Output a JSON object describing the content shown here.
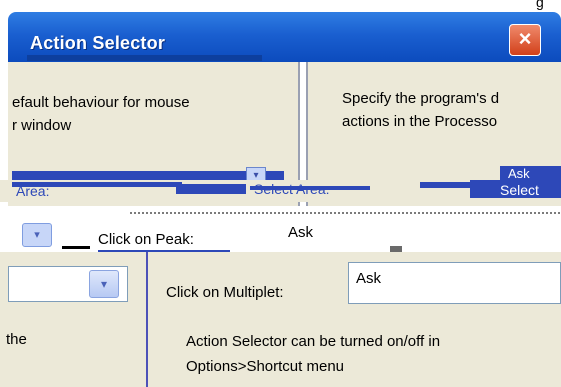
{
  "corner_text": "g",
  "window": {
    "title": "Action Selector",
    "close_glyph": "×"
  },
  "left_panel": {
    "description_line1": "efault behaviour for mouse",
    "description_line2": "r window",
    "select_arrow_glyph": "▾"
  },
  "right_panel": {
    "description_line1": "Specify the program's d",
    "description_line2": "actions in the Processo",
    "select_value_fragment": "Ask"
  },
  "glitch": {
    "fragment_area": "Area:",
    "fragment_select_area": "Select Area:",
    "fragment_select": "Select"
  },
  "peak": {
    "label": "Click on Peak:",
    "value": "Ask",
    "arrow_glyph": "▾"
  },
  "bottom_left": {
    "arrow_glyph": "▾",
    "text_fragment": "the"
  },
  "multiplet": {
    "label": "Click on Multiplet:",
    "value": "Ask"
  },
  "info": {
    "line1": "Action Selector can be turned on/off in",
    "line2": "Options>Shortcut menu"
  },
  "colors": {
    "titlebar": "#1a5fd0",
    "panel": "#ece9d8",
    "accent_blue": "#2d48b8",
    "close_red": "#d2401a"
  },
  "icons": {
    "close": "close-icon",
    "dropdown": "chevron-down-icon"
  }
}
